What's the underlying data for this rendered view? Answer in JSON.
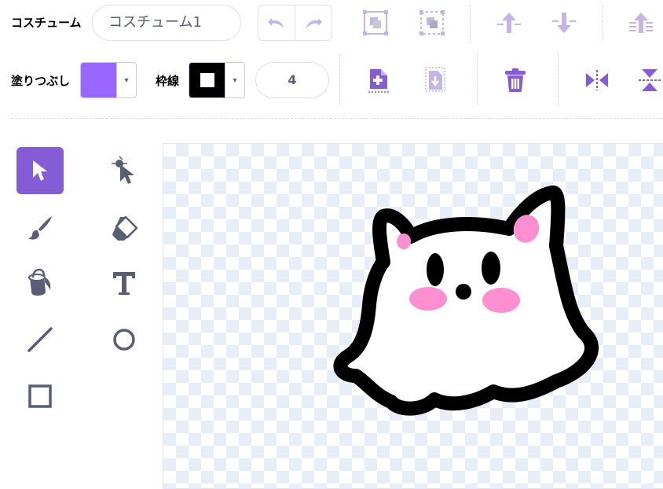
{
  "toolbar": {
    "costume_label": "コスチューム",
    "costume_name": "コスチューム1",
    "fill_label": "塗りつぶし",
    "outline_label": "枠線",
    "outline_width": "4",
    "dropdown_arrow": "▾",
    "fill_color": "#9966ff",
    "outline_color": "#000000"
  },
  "colors": {
    "accent": "#855cd6",
    "icon_light": "#c4b5e6",
    "icon_gray": "#9a9fb0",
    "tool_gray": "#575e75"
  }
}
